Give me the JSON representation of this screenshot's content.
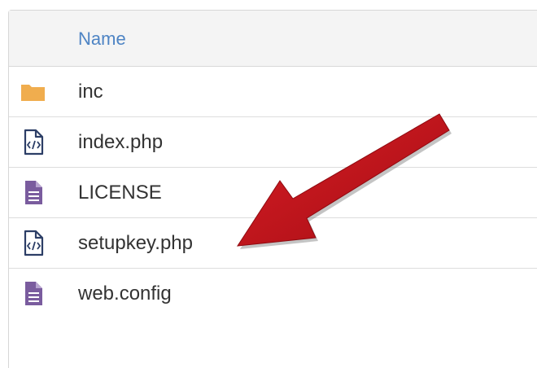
{
  "file_list": {
    "column_header": "Name",
    "items": [
      {
        "name": "inc",
        "icon": "folder-icon"
      },
      {
        "name": "index.php",
        "icon": "code-file-icon"
      },
      {
        "name": "LICENSE",
        "icon": "text-file-icon"
      },
      {
        "name": "setupkey.php",
        "icon": "code-file-icon"
      },
      {
        "name": "web.config",
        "icon": "text-file-icon"
      }
    ]
  },
  "colors": {
    "header_text": "#4e84c4",
    "folder": "#f0ad4e",
    "code_file": "#2c3e66",
    "text_file": "#7a5c9e",
    "annotation_arrow": "#c0121a"
  }
}
